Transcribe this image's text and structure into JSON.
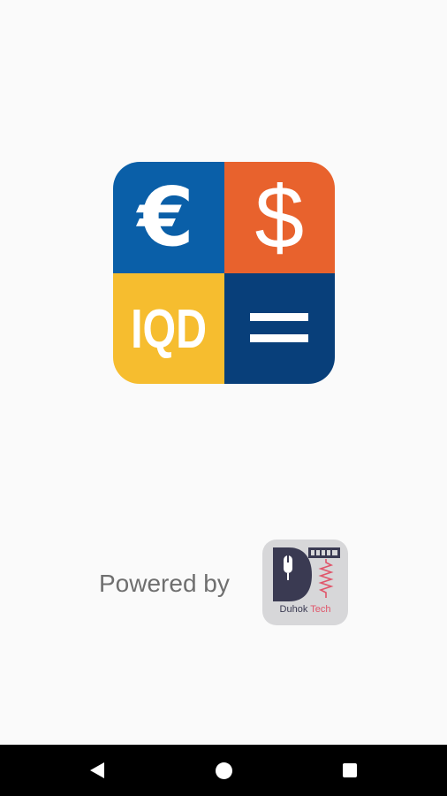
{
  "app_logo": {
    "euro_symbol": "€",
    "dollar_symbol": "$",
    "iqd_text": "IQD",
    "colors": {
      "euro_bg": "#0a5fa8",
      "dollar_bg": "#e8622d",
      "iqd_bg": "#f6bd2f",
      "equals_bg": "#083f7a"
    }
  },
  "footer": {
    "powered_by": "Powered by",
    "company_name_part1": "Duhok",
    "company_name_part2": "Tech"
  },
  "nav_bar": {
    "icons": [
      "back-icon",
      "home-icon",
      "recents-icon"
    ]
  }
}
